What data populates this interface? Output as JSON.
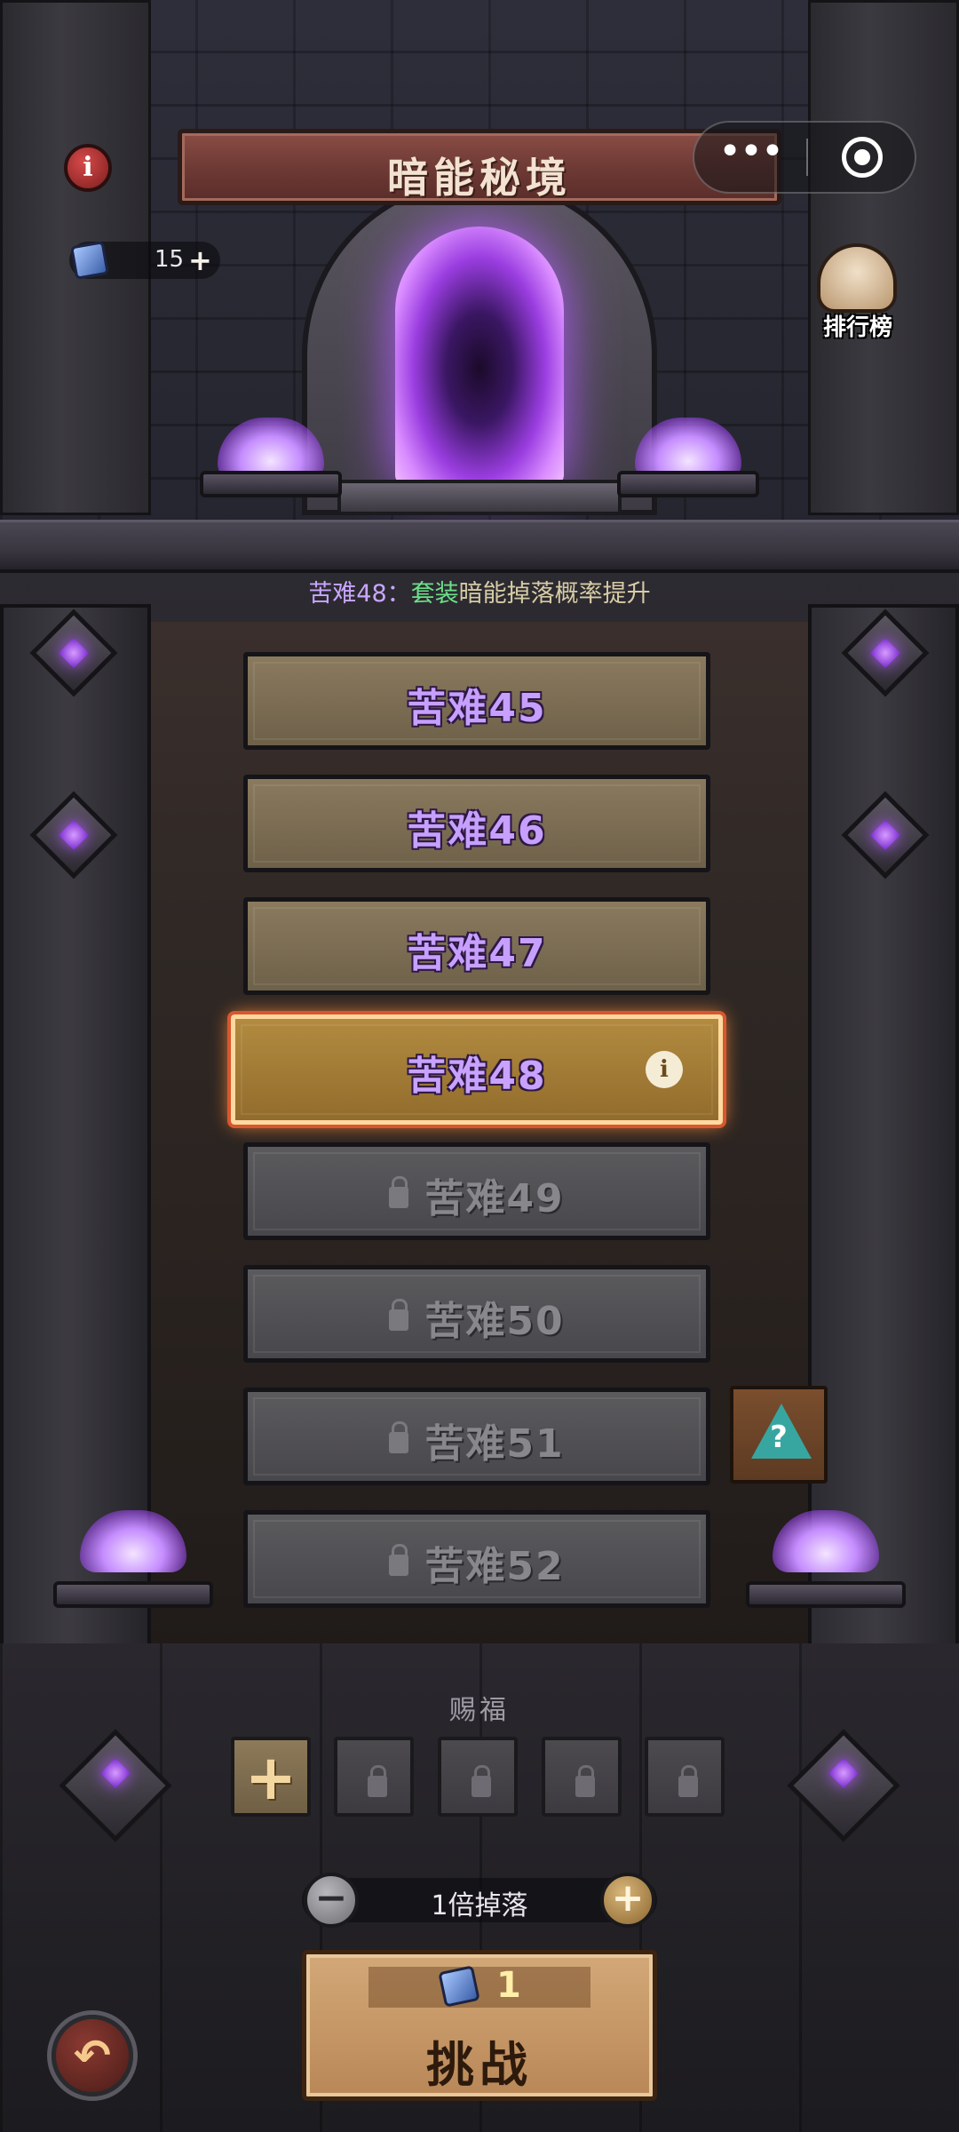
{
  "header": {
    "title": "暗能秘境",
    "info_icon": "info-icon",
    "menu_more": "•••",
    "energy": {
      "icon": "crystal-ticket-icon",
      "value": "15",
      "add": "+"
    },
    "leaderboard": {
      "icon": "podium-icon",
      "label": "排行榜"
    }
  },
  "notice": {
    "level": "苦难48：",
    "highlight": "套装",
    "rest": "暗能掉落概率提升",
    "colors": {
      "level": "#c9a6ff",
      "highlight": "#6ee08a",
      "rest": "#d7cba6"
    }
  },
  "levels": [
    {
      "label": "苦难45",
      "state": "open"
    },
    {
      "label": "苦难46",
      "state": "open"
    },
    {
      "label": "苦难47",
      "state": "open"
    },
    {
      "label": "苦难48",
      "state": "selected",
      "info": "i"
    },
    {
      "label": "苦难49",
      "state": "locked"
    },
    {
      "label": "苦难50",
      "state": "locked"
    },
    {
      "label": "苦难51",
      "state": "locked"
    },
    {
      "label": "苦难52",
      "state": "locked"
    }
  ],
  "hint_button": {
    "icon": "warning-question-icon",
    "symbol": "?"
  },
  "blessing": {
    "label": "赐福",
    "slots": [
      {
        "type": "add",
        "symbol": "+"
      },
      {
        "type": "locked"
      },
      {
        "type": "locked"
      },
      {
        "type": "locked"
      },
      {
        "type": "locked"
      }
    ]
  },
  "drop": {
    "minus": "−",
    "text": "1倍掉落",
    "plus": "+"
  },
  "challenge": {
    "cost_icon": "crystal-ticket-icon",
    "cost": "1",
    "label": "挑战"
  },
  "back_button": {
    "icon": "back-arrow-icon",
    "symbol": "↶"
  }
}
